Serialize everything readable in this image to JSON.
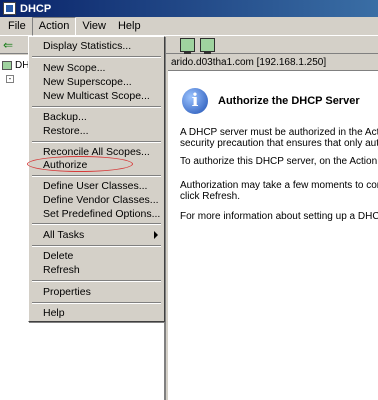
{
  "window": {
    "title": "DHCP"
  },
  "menubar": {
    "items": [
      "File",
      "Action",
      "View",
      "Help"
    ]
  },
  "tree": {
    "root_label": "DHCP"
  },
  "address": "arido.d03tha1.com [192.168.1.250]",
  "info": {
    "title": "Authorize the DHCP Server",
    "paragraphs": [
      "A DHCP server must be authorized in the Active Di",
      "security precaution that ensures that only authoris",
      "To authorize this DHCP server, on the Action menu",
      "Authorization may take a few moments to complete",
      "click Refresh.",
      "For more information about setting up a DHCP serv"
    ]
  },
  "action_menu": {
    "items": [
      "Display Statistics...",
      "New Scope...",
      "New Superscope...",
      "New Multicast Scope...",
      "Backup...",
      "Restore...",
      "Reconcile All Scopes...",
      "Authorize",
      "Define User Classes...",
      "Define Vendor Classes...",
      "Set Predefined Options...",
      "All Tasks",
      "Delete",
      "Refresh",
      "Properties",
      "Help"
    ],
    "highlighted": "Authorize"
  },
  "colors": {
    "title_bar": "#0a246a",
    "highlight_ring": "#d63a3a",
    "face": "#d4d0c8"
  }
}
